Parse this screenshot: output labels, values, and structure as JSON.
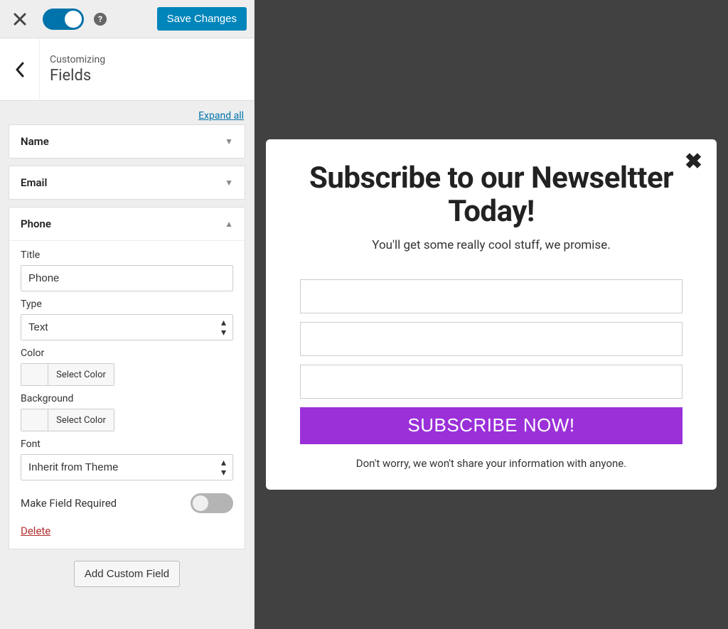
{
  "topbar": {
    "save_label": "Save Changes"
  },
  "header": {
    "eyebrow": "Customizing",
    "title": "Fields",
    "expand_all": "Expand all"
  },
  "accordion_items": {
    "name": {
      "label": "Name"
    },
    "email": {
      "label": "Email"
    },
    "phone": {
      "label": "Phone"
    }
  },
  "phone_panel": {
    "title_label": "Title",
    "title_value": "Phone",
    "type_label": "Type",
    "type_value": "Text",
    "color_label": "Color",
    "select_color": "Select Color",
    "background_label": "Background",
    "font_label": "Font",
    "font_value": "Inherit from Theme",
    "required_label": "Make Field Required",
    "delete_label": "Delete"
  },
  "add_field_label": "Add Custom Field",
  "popup": {
    "title": "Subscribe to our Newseltter Today!",
    "subtitle": "You'll get some really cool stuff, we promise.",
    "button": "SUBSCRIBE NOW!",
    "disclaimer": "Don't worry, we won't share your information with anyone."
  }
}
